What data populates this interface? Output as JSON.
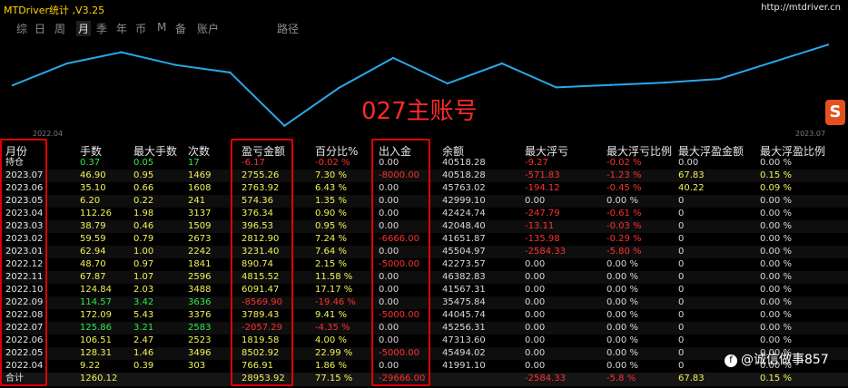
{
  "window": {
    "title": "MTDriver统计 ,V3.25",
    "url": "http://mtdriver.cn"
  },
  "tabs": [
    {
      "label": "综",
      "active": false
    },
    {
      "label": "日",
      "active": false
    },
    {
      "label": "周",
      "active": false
    },
    {
      "label": "月",
      "active": true
    },
    {
      "label": "季",
      "active": false
    },
    {
      "label": "年",
      "active": false
    },
    {
      "label": "币",
      "active": false
    },
    {
      "label": "M",
      "active": false
    },
    {
      "label": "备",
      "active": false
    },
    {
      "label": "账户",
      "active": false
    },
    {
      "label": "路径",
      "active": false
    }
  ],
  "overlay": {
    "label": "027主账号"
  },
  "chart_data": {
    "type": "line",
    "x": [
      "2022.04",
      "2022.05",
      "2022.06",
      "2022.07",
      "2022.08",
      "2022.09",
      "2022.10",
      "2022.11",
      "2022.12",
      "2023.01",
      "2023.02",
      "2023.03",
      "2023.04",
      "2023.05",
      "2023.06",
      "2023.07"
    ],
    "x_start_label": "2022.04",
    "x_end_label": "2023.07",
    "series": [
      {
        "values": [
          41991.1,
          45494.02,
          47313.6,
          45256.31,
          44045.74,
          35475.84,
          41567.31,
          46382.83,
          42273.57,
          45504.97,
          41651.87,
          42048.4,
          42424.74,
          42999.1,
          45763.02,
          48518.28
        ]
      }
    ],
    "grid": false,
    "color": "#2aa8e8"
  },
  "table": {
    "headers": [
      "月份",
      "手数",
      "最大手数",
      "次数",
      "盈亏金额",
      "百分比%",
      "出入金",
      "余额",
      "最大浮亏",
      "最大浮亏比例",
      "最大浮盈金额",
      "最大浮盈比例"
    ],
    "rows": [
      {
        "c": [
          "持仓",
          "0.37",
          "0.05",
          "17",
          "-6.17",
          "-0.02 %",
          "0.00",
          "40518.28",
          "-9.27",
          "-0.02 %",
          "0.00",
          "0.00 %"
        ],
        "k": [
          "lbl",
          "g",
          "g",
          "g",
          "r",
          "r",
          "w",
          "w",
          "r",
          "r",
          "w",
          "w"
        ]
      },
      {
        "c": [
          "2023.07",
          "46.90",
          "0.95",
          "1469",
          "2755.26",
          "7.30 %",
          "-8000.00",
          "40518.28",
          "-571.83",
          "-1.23 %",
          "67.83",
          "0.15 %"
        ],
        "k": [
          "lbl",
          "y",
          "y",
          "y",
          "y",
          "y",
          "r",
          "w",
          "r",
          "r",
          "y",
          "y"
        ]
      },
      {
        "c": [
          "2023.06",
          "35.10",
          "0.66",
          "1608",
          "2763.92",
          "6.43 %",
          "0.00",
          "45763.02",
          "-194.12",
          "-0.45 %",
          "40.22",
          "0.09 %"
        ],
        "k": [
          "lbl",
          "y",
          "y",
          "y",
          "y",
          "y",
          "w",
          "w",
          "r",
          "r",
          "y",
          "y"
        ]
      },
      {
        "c": [
          "2023.05",
          "6.20",
          "0.22",
          "241",
          "574.36",
          "1.35 %",
          "0.00",
          "42999.10",
          "0.00",
          "0.00 %",
          "0",
          "0.00 %"
        ],
        "k": [
          "lbl",
          "y",
          "y",
          "y",
          "y",
          "y",
          "w",
          "w",
          "w",
          "w",
          "w",
          "w"
        ]
      },
      {
        "c": [
          "2023.04",
          "112.26",
          "1.98",
          "3137",
          "376.34",
          "0.90 %",
          "0.00",
          "42424.74",
          "-247.79",
          "-0.61 %",
          "0",
          "0.00 %"
        ],
        "k": [
          "lbl",
          "y",
          "y",
          "y",
          "y",
          "y",
          "w",
          "w",
          "r",
          "r",
          "w",
          "w"
        ]
      },
      {
        "c": [
          "2023.03",
          "38.79",
          "0.46",
          "1509",
          "396.53",
          "0.95 %",
          "0.00",
          "42048.40",
          "-13.11",
          "-0.03 %",
          "0",
          "0.00 %"
        ],
        "k": [
          "lbl",
          "y",
          "y",
          "y",
          "y",
          "y",
          "w",
          "w",
          "r",
          "r",
          "w",
          "w"
        ]
      },
      {
        "c": [
          "2023.02",
          "59.59",
          "0.79",
          "2673",
          "2812.90",
          "7.24 %",
          "-6666.00",
          "41651.87",
          "-135.98",
          "-0.29 %",
          "0",
          "0.00 %"
        ],
        "k": [
          "lbl",
          "y",
          "y",
          "y",
          "y",
          "y",
          "r",
          "w",
          "r",
          "r",
          "w",
          "w"
        ]
      },
      {
        "c": [
          "2023.01",
          "62.94",
          "1.00",
          "2242",
          "3231.40",
          "7.64 %",
          "0.00",
          "45504.97",
          "-2584.33",
          "-5.80 %",
          "0",
          "0.00 %"
        ],
        "k": [
          "lbl",
          "y",
          "y",
          "y",
          "y",
          "y",
          "w",
          "w",
          "r",
          "r",
          "w",
          "w"
        ]
      },
      {
        "c": [
          "2022.12",
          "48.70",
          "0.97",
          "1841",
          "890.74",
          "2.15 %",
          "-5000.00",
          "42273.57",
          "0.00",
          "0.00 %",
          "0",
          "0.00 %"
        ],
        "k": [
          "lbl",
          "y",
          "y",
          "y",
          "y",
          "y",
          "r",
          "w",
          "w",
          "w",
          "w",
          "w"
        ]
      },
      {
        "c": [
          "2022.11",
          "67.87",
          "1.07",
          "2596",
          "4815.52",
          "11.58 %",
          "0.00",
          "46382.83",
          "0.00",
          "0.00 %",
          "0",
          "0.00 %"
        ],
        "k": [
          "lbl",
          "y",
          "y",
          "y",
          "y",
          "y",
          "w",
          "w",
          "w",
          "w",
          "w",
          "w"
        ]
      },
      {
        "c": [
          "2022.10",
          "124.84",
          "2.03",
          "3488",
          "6091.47",
          "17.17 %",
          "0.00",
          "41567.31",
          "0.00",
          "0.00 %",
          "0",
          "0.00 %"
        ],
        "k": [
          "lbl",
          "y",
          "y",
          "y",
          "y",
          "y",
          "w",
          "w",
          "w",
          "w",
          "w",
          "w"
        ]
      },
      {
        "c": [
          "2022.09",
          "114.57",
          "3.42",
          "3636",
          "-8569.90",
          "-19.46 %",
          "0.00",
          "35475.84",
          "0.00",
          "0.00 %",
          "0",
          "0.00 %"
        ],
        "k": [
          "lbl",
          "g",
          "g",
          "g",
          "r",
          "r",
          "w",
          "w",
          "w",
          "w",
          "w",
          "w"
        ]
      },
      {
        "c": [
          "2022.08",
          "172.09",
          "5.43",
          "3376",
          "3789.43",
          "9.41 %",
          "-5000.00",
          "44045.74",
          "0.00",
          "0.00 %",
          "0",
          "0.00 %"
        ],
        "k": [
          "lbl",
          "y",
          "y",
          "y",
          "y",
          "y",
          "r",
          "w",
          "w",
          "w",
          "w",
          "w"
        ]
      },
      {
        "c": [
          "2022.07",
          "125.86",
          "3.21",
          "2583",
          "-2057.29",
          "-4.35 %",
          "0.00",
          "45256.31",
          "0.00",
          "0.00 %",
          "0",
          "0.00 %"
        ],
        "k": [
          "lbl",
          "g",
          "g",
          "g",
          "r",
          "r",
          "w",
          "w",
          "w",
          "w",
          "w",
          "w"
        ]
      },
      {
        "c": [
          "2022.06",
          "106.51",
          "2.47",
          "2523",
          "1819.58",
          "4.00 %",
          "0.00",
          "47313.60",
          "0.00",
          "0.00 %",
          "0",
          "0.00 %"
        ],
        "k": [
          "lbl",
          "y",
          "y",
          "y",
          "y",
          "y",
          "w",
          "w",
          "w",
          "w",
          "w",
          "w"
        ]
      },
      {
        "c": [
          "2022.05",
          "128.31",
          "1.46",
          "3496",
          "8502.92",
          "22.99 %",
          "-5000.00",
          "45494.02",
          "0.00",
          "0.00 %",
          "0",
          "0.00 %"
        ],
        "k": [
          "lbl",
          "y",
          "y",
          "y",
          "y",
          "y",
          "r",
          "w",
          "w",
          "w",
          "w",
          "w"
        ]
      },
      {
        "c": [
          "2022.04",
          "9.22",
          "0.39",
          "303",
          "766.91",
          "1.86 %",
          "0.00",
          "41991.10",
          "0.00",
          "0.00 %",
          "0",
          "0.00 %"
        ],
        "k": [
          "lbl",
          "y",
          "y",
          "y",
          "y",
          "y",
          "w",
          "w",
          "w",
          "w",
          "w",
          "w"
        ]
      }
    ],
    "total": {
      "c": [
        "合计",
        "1260.12",
        "",
        "",
        "28953.92",
        "77.15 %",
        "-29666.00",
        "",
        "-2584.33",
        "-5.8 %",
        "67.83",
        "0.15 %"
      ],
      "k": [
        "lbl",
        "y",
        "y",
        "y",
        "y",
        "y",
        "r",
        "w",
        "r",
        "r",
        "y",
        "y"
      ]
    }
  },
  "watermark": {
    "icon": "toutiao-icon",
    "text": "@诚信做事857"
  }
}
